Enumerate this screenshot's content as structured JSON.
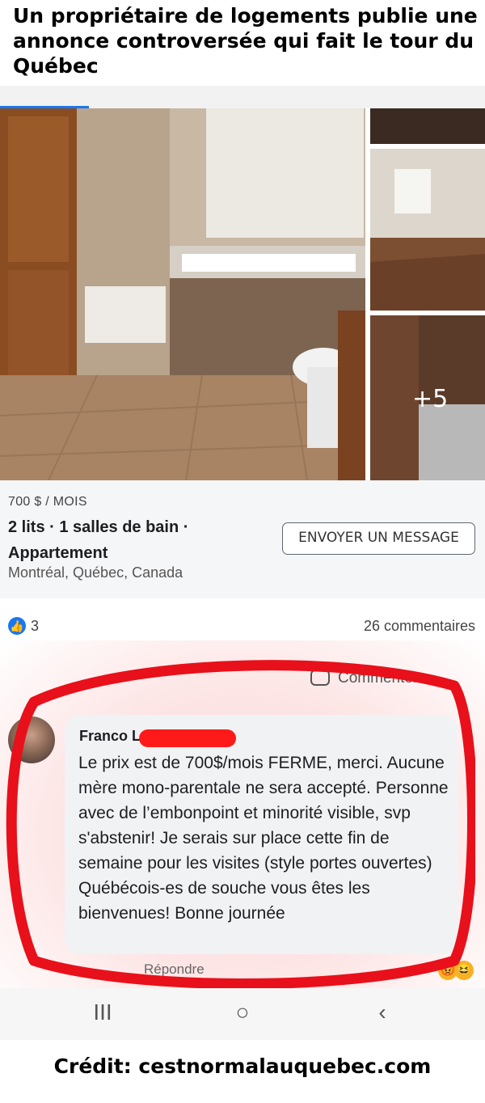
{
  "headline": "Un propriétaire de logements publie une annonce controversée qui fait le tour du Québec",
  "gallery": {
    "more_photos_label": "+5"
  },
  "listing": {
    "price": "700 $ / MOIS",
    "specs": "2 lits · 1 salles de bain · Appartement",
    "location": "Montréal, Québec, Canada",
    "message_button": "ENVOYER UN MESSAGE"
  },
  "stats": {
    "likes": "3",
    "comments": "26 commentaires"
  },
  "actions": {
    "comment": "Commenter",
    "reply": "Répondre"
  },
  "comment": {
    "author": "Franco L",
    "text": "Le prix est de 700$/mois FERME, merci. Aucune mère mono-parentale ne sera accepté. Personne avec de l’embonpoint et minorité visible, svp s'abstenir! Je serais sur place cette fin de semaine pour les visites (style portes ouvertes) Québécois-es de souche vous êtes les bienvenues! Bonne journée"
  },
  "navbar": {
    "recents_icon": "III",
    "home_icon": "○",
    "back_icon": "‹"
  },
  "credit": "Crédit: cestnormalauquebec.com",
  "colors": {
    "accent": "#1877f2",
    "highlight_ring": "#e8101a",
    "redaction": "#ff1a1a"
  }
}
